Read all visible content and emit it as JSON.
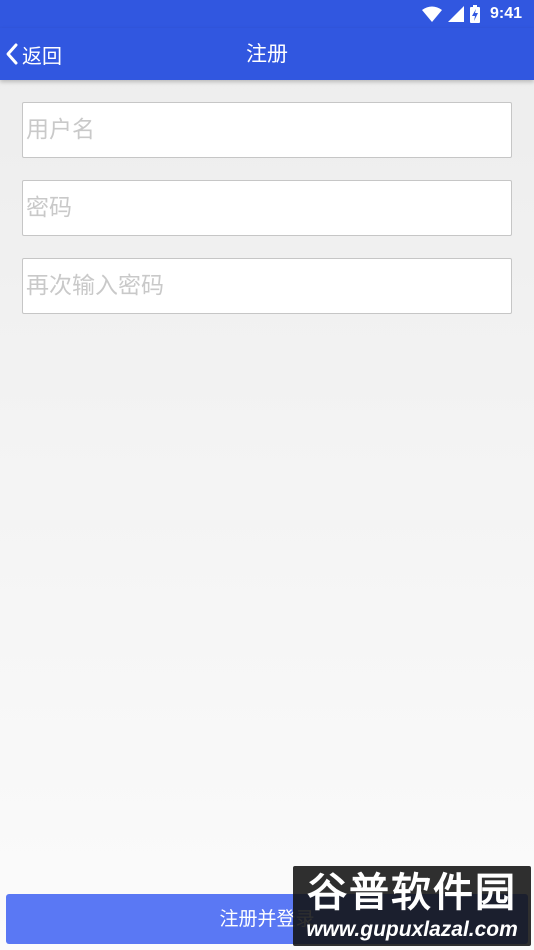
{
  "status_bar": {
    "time": "9:41",
    "icons": [
      "wifi-icon",
      "cellular-signal-icon",
      "battery-charging-icon"
    ]
  },
  "app_bar": {
    "back_label": "返回",
    "title": "注册"
  },
  "form": {
    "username_placeholder": "用户名",
    "password_placeholder": "密码",
    "confirm_password_placeholder": "再次输入密码"
  },
  "submit_label": "注册并登录",
  "watermark": {
    "logo_text": "谷普软件园",
    "url": "www.gupuxlazal.com"
  },
  "colors": {
    "primary": "#3157e0",
    "button": "#5a78f4",
    "placeholder": "#c9c9c9",
    "background": "#efefef"
  }
}
